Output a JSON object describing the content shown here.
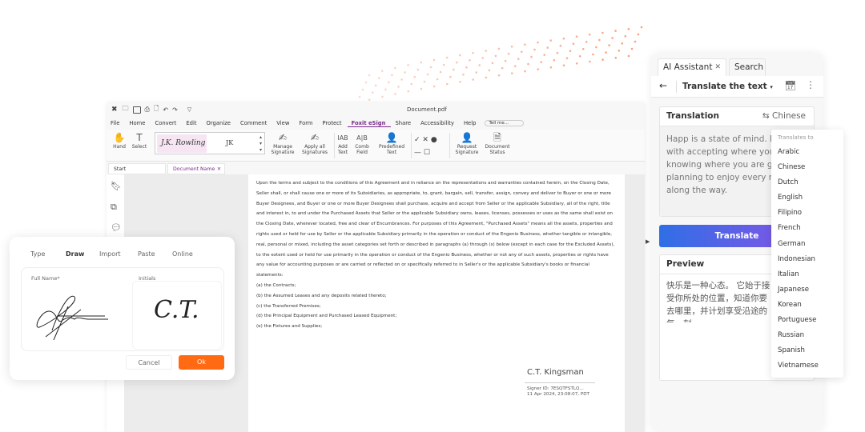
{
  "app": {
    "title": "Document.pdf",
    "menu": [
      "File",
      "Home",
      "Convert",
      "Edit",
      "Organize",
      "Comment",
      "View",
      "Form",
      "Protect",
      "Foxit eSign",
      "Share",
      "Accessibility",
      "Help"
    ],
    "active_menu": "Foxit eSign",
    "tell_me": "Tell me...",
    "ribbon": {
      "hand": "Hand",
      "select": "Select",
      "sig_full": "J.K. Rowling",
      "sig_initials": "JK",
      "manage": "Manage Signature",
      "apply_all": "Apply all Signatures",
      "add_text": "Add Text",
      "comb_field": "Comb Field",
      "predefined": "Predefined Text",
      "request": "Request Signature",
      "status": "Document Status"
    },
    "tabs": {
      "start": "Start",
      "doc": "Document Name"
    },
    "accent": "#7a2a8c"
  },
  "document": {
    "paragraph": "Upon the terms and subject to the conditions of this Agreement and in reliance on the representations and warranties contained herein, on the Closing Date, Seller shall, or shall cause one or more of its Subsidiaries, as appropriate, to, grant, bargain, sell, transfer, assign, convey and deliver to Buyer or one or more Buyer Designees, and Buyer or one or more Buyer Designees shall purchase, acquire and accept from Seller or the applicable Subsidiary, all of the right, title and interest in, to and under the Purchased Assets that Seller or the applicable Subsidiary owns, leases, licenses, possesses or uses as the same shall exist on the Closing Date, wherever located, free and clear of Encumbrances. For purposes of this Agreement, \"Purchased Assets\" means all the assets, properties and rights used or held for use by Seller or the applicable Subsidiary primarily in the operation or conduct of the Engenio Business, whether tangible or intangible, real, personal or mixed, including the asset categories set forth or described in paragraphs (a) through (s) below (except in each case for the Excluded Assets), to the extent used or held for use primarily in the operation or conduct of the Engenio Business, whether or not any of such assets, properties or rights have any value for accounting purposes or are carried or reflected on or specifically referred to in Seller's or the applicable Subsidiary's books or financial statements:",
    "items": [
      "(a) the Contracts;",
      "(b) the Assumed Leases and any deposits related thereto;",
      "(c) the Transferred Premises;",
      "(d) the Principal Equipment and Purchased Leased Equipment;",
      "(e) the Fixtures and Supplies;"
    ],
    "signer_name": "C.T. Kingsman",
    "signer_id": "Signer ID: 7ESQTFSTLQ...",
    "signed_at": "11 Apr 2024, 23:08:07, PDT"
  },
  "signature_dialog": {
    "tabs": [
      "Type",
      "Draw",
      "Import",
      "Paste",
      "Online"
    ],
    "active_tab": "Draw",
    "full_name_label": "Full Name*",
    "initials_label": "Initials",
    "initials_drawn": "C.T.",
    "cancel": "Cancel",
    "ok": "Ok",
    "ok_color": "#ff6a13"
  },
  "ai_panel": {
    "tab_ai": "AI Assistant",
    "tab_search": "Search",
    "mode": "Translate the text",
    "translation_label": "Translation",
    "target_lang": "Chinese",
    "source_text": "Happ is a state of mind. It starts with accepting where you are, knowing where you are go and planning to enjoy every moment along the way.",
    "translate_button": "Translate",
    "preview_label": "Preview",
    "preview_text": "快乐是一种心态。 它始于接受你所处的位置，知道你要去哪里，并计划享受沿途的每一刻。",
    "dropdown_header": "Translates to",
    "languages": [
      "Arabic",
      "Chinese",
      "Dutch",
      "English",
      "Filipino",
      "French",
      "German",
      "Indonesian",
      "Italian",
      "Japanese",
      "Korean",
      "Portuguese",
      "Russian",
      "Spanish",
      "Vietnamese"
    ]
  }
}
